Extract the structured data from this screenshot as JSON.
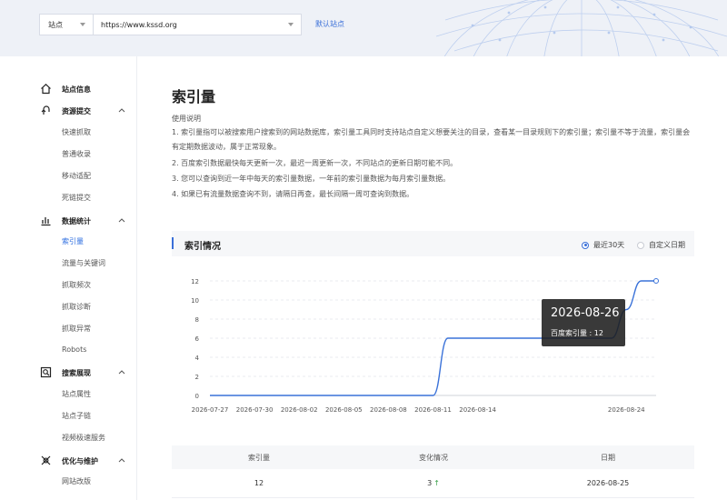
{
  "header": {
    "site_type_label": "站点",
    "url_value": "https://www.kssd.org",
    "default_site_link": "默认站点"
  },
  "sidebar": {
    "groups": [
      {
        "label": "站点信息",
        "icon": "home-icon",
        "items": []
      },
      {
        "label": "资源提交",
        "icon": "upload-icon",
        "items": [
          "快速抓取",
          "普通收录",
          "移动适配",
          "死链提交"
        ]
      },
      {
        "label": "数据统计",
        "icon": "bar-chart-icon",
        "items": [
          "索引量",
          "流量与关键词",
          "抓取频次",
          "抓取诊断",
          "抓取异常",
          "Robots"
        ]
      },
      {
        "label": "搜索展现",
        "icon": "search-display-icon",
        "items": [
          "站点属性",
          "站点子链",
          "视频极速服务"
        ]
      },
      {
        "label": "优化与维护",
        "icon": "optimize-icon",
        "items": [
          "网站改版"
        ]
      }
    ],
    "active_item": "索引量"
  },
  "page": {
    "title": "索引量",
    "usage_heading": "使用说明",
    "notes": [
      "1. 索引量指可以被搜索用户搜索到的网站数据库，索引量工具同时支持站点自定义想要关注的目录，查看某一目录规则下的索引量；索引量不等于流量，索引量会有定期数据波动，属于正常现象。",
      "2. 百度索引数据最快每天更新一次，最迟一周更新一次，不同站点的更新日期可能不同。",
      "3. 您可以查询到近一年中每天的索引量数据，一年前的索引量数据为每月索引量数据。",
      "4. 如果已有流量数据查询不到，请隔日再查，最长间隔一周可查询到数据。"
    ]
  },
  "section": {
    "title": "索引情况",
    "radio_recent": "最近30天",
    "radio_custom": "自定义日期"
  },
  "tooltip": {
    "date": "2026-08-26",
    "value_text": "百度索引量 : 12"
  },
  "table": {
    "headers": [
      "索引量",
      "变化情况",
      "日期"
    ],
    "rows": [
      {
        "index": "12",
        "change": "3",
        "arrow": "↑",
        "date": "2026-08-25"
      }
    ]
  },
  "chart_data": {
    "type": "line",
    "title": "",
    "xlabel": "",
    "ylabel": "",
    "ylim": [
      0,
      12
    ],
    "yticks": [
      0,
      2,
      4,
      6,
      8,
      10,
      12
    ],
    "xticks": [
      "2026-07-27",
      "2026-07-30",
      "2026-08-02",
      "2026-08-05",
      "2026-08-08",
      "2026-08-11",
      "2026-08-14",
      "2026-08-24"
    ],
    "grid": true,
    "color": "#3a72d9",
    "series": [
      {
        "x": [
          "2026-07-27",
          "2026-07-28",
          "2026-07-29",
          "2026-07-30",
          "2026-07-31",
          "2026-08-01",
          "2026-08-02",
          "2026-08-03",
          "2026-08-04",
          "2026-08-05",
          "2026-08-06",
          "2026-08-07",
          "2026-08-08",
          "2026-08-09",
          "2026-08-10",
          "2026-08-11",
          "2026-08-12",
          "2026-08-13",
          "2026-08-14",
          "2026-08-15",
          "2026-08-16",
          "2026-08-17",
          "2026-08-18",
          "2026-08-19",
          "2026-08-20",
          "2026-08-21",
          "2026-08-22",
          "2026-08-23",
          "2026-08-24",
          "2026-08-25",
          "2026-08-26"
        ],
        "values": [
          0,
          0,
          0,
          0,
          0,
          0,
          0,
          0,
          0,
          0,
          0,
          0,
          0,
          0,
          0,
          0,
          6,
          6,
          6,
          6,
          6,
          6,
          6,
          6,
          6,
          6,
          6,
          6,
          9,
          12,
          12
        ]
      }
    ]
  }
}
